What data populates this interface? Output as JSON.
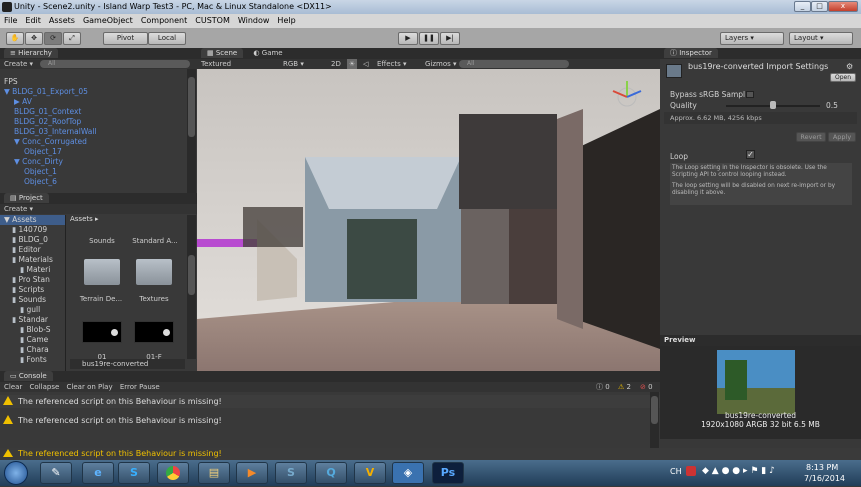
{
  "window": {
    "title": "Unity - Scene2.unity - Island Warp Test3 - PC, Mac & Linux Standalone <DX11>",
    "minimize": "_",
    "maximize": "□",
    "close": "x"
  },
  "menu": [
    "File",
    "Edit",
    "Assets",
    "GameObject",
    "Component",
    "CUSTOM",
    "Window",
    "Help"
  ],
  "toolbar": {
    "pivot": "Pivot",
    "local": "Local",
    "layers": "Layers",
    "layout": "Layout"
  },
  "hierarchy": {
    "tab": "Hierarchy",
    "create": "Create",
    "search": "All",
    "items": [
      {
        "label": "FPS",
        "blue": false,
        "indent": 0,
        "arrow": ""
      },
      {
        "label": "BLDG_01_Export_05",
        "blue": true,
        "indent": 0,
        "arrow": "▼"
      },
      {
        "label": "AV",
        "blue": true,
        "indent": 1,
        "arrow": "▶"
      },
      {
        "label": "BLDG_01_Context",
        "blue": true,
        "indent": 1,
        "arrow": ""
      },
      {
        "label": "BLDG_02_RoofTop",
        "blue": true,
        "indent": 1,
        "arrow": ""
      },
      {
        "label": "BLDG_03_InternalWall",
        "blue": true,
        "indent": 1,
        "arrow": ""
      },
      {
        "label": "Conc_Corrugated",
        "blue": true,
        "indent": 1,
        "arrow": "▼"
      },
      {
        "label": "Object_17",
        "blue": true,
        "indent": 2,
        "arrow": ""
      },
      {
        "label": "Conc_Dirty",
        "blue": true,
        "indent": 1,
        "arrow": "▼"
      },
      {
        "label": "Object_1",
        "blue": true,
        "indent": 2,
        "arrow": ""
      },
      {
        "label": "Object_6",
        "blue": true,
        "indent": 2,
        "arrow": ""
      }
    ]
  },
  "project": {
    "tab": "Project",
    "create": "Create",
    "tree_root": "Assets",
    "tree": [
      {
        "label": "140709",
        "indent": 1
      },
      {
        "label": "BLDG_0",
        "indent": 1
      },
      {
        "label": "Editor",
        "indent": 1
      },
      {
        "label": "Materials",
        "indent": 1
      },
      {
        "label": "Materi",
        "indent": 2
      },
      {
        "label": "Pro Stan",
        "indent": 1
      },
      {
        "label": "Scripts",
        "indent": 1
      },
      {
        "label": "Sounds",
        "indent": 1
      },
      {
        "label": "gull",
        "indent": 2
      },
      {
        "label": "Standar",
        "indent": 1
      },
      {
        "label": "Blob-S",
        "indent": 2
      },
      {
        "label": "Came",
        "indent": 2
      },
      {
        "label": "Chara",
        "indent": 2
      },
      {
        "label": "Fonts",
        "indent": 2
      }
    ],
    "breadcrumb": "Assets",
    "grid_top": [
      "Sounds",
      "Standard A..."
    ],
    "grid_mid": [
      "Terrain De...",
      "Textures"
    ],
    "grid_bot": [
      "01",
      "01-F"
    ],
    "selected_file": "bus19re-converted"
  },
  "scene": {
    "tab_scene": "Scene",
    "tab_game": "Game",
    "shading": "Textured",
    "render": "RGB",
    "two_d": "2D",
    "effects": "Effects",
    "gizmos": "Gizmos",
    "search": "All"
  },
  "inspector": {
    "tab": "Inspector",
    "asset_title": "bus19re-converted Import Settings",
    "open": "Open",
    "bypass_label": "Bypass sRGB Sampl",
    "quality_label": "Quality",
    "quality_value": "0.5",
    "quality_fraction": 0.5,
    "approx": "Approx. 6.62 MB, 4256 kbps",
    "revert": "Revert",
    "apply": "Apply",
    "loop_label": "Loop",
    "loop_check": "✓",
    "help1": "The Loop setting in the Inspector is obsolete. Use the Scripting API to control looping instead.",
    "help2": "The loop setting will be disabled on next re-import or by disabling it above.",
    "preview_label": "Preview",
    "preview_name": "bus19re-converted",
    "preview_info": "1920x1080 ARGB 32 bit  6.5 MB"
  },
  "console": {
    "tab": "Console",
    "buttons": [
      "Clear",
      "Collapse",
      "Clear on Play",
      "Error Pause"
    ],
    "counts": [
      "0",
      "2",
      "0"
    ],
    "rows": [
      "The referenced script on this Behaviour is missing!",
      "The referenced script on this Behaviour is missing!"
    ]
  },
  "status": {
    "message": "The referenced script on this Behaviour is missing!"
  },
  "taskbar": {
    "lang": "CH",
    "time": "8:13 PM",
    "date": "7/16/2014",
    "apps": [
      "Ps"
    ]
  }
}
